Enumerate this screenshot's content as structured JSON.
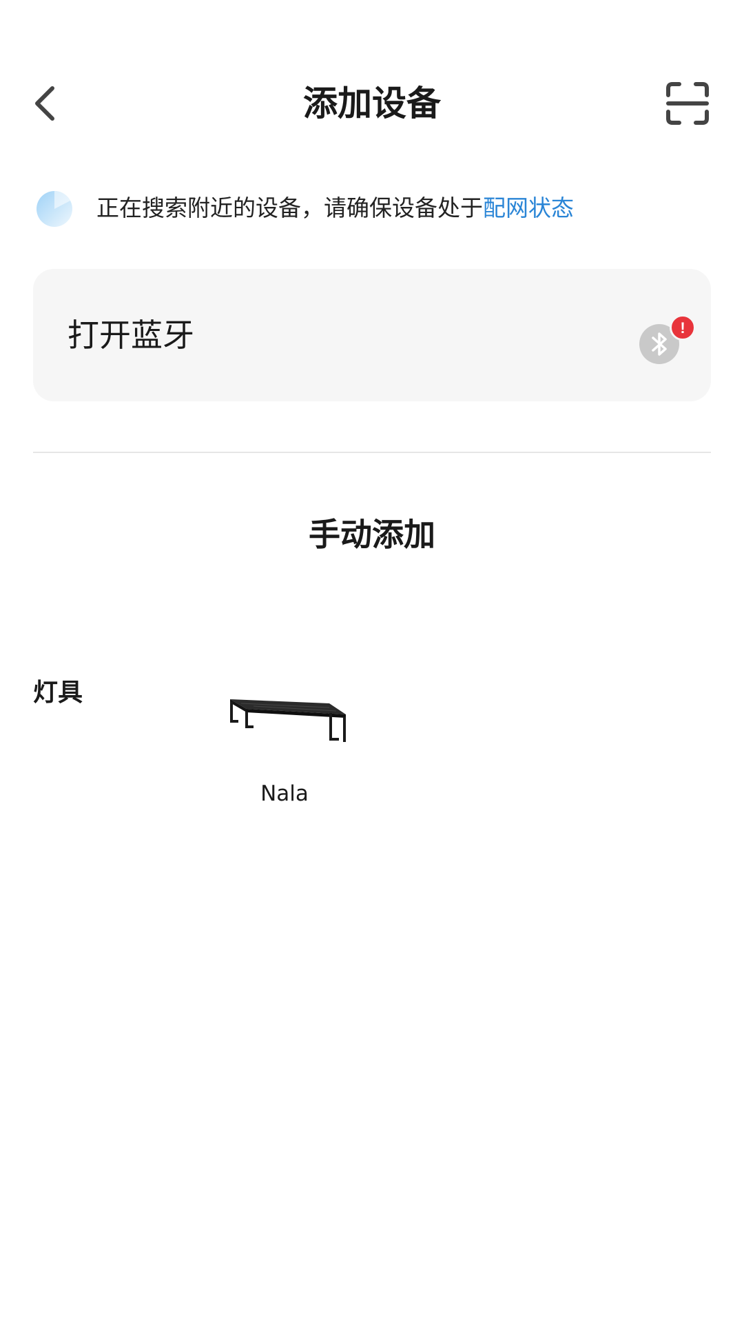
{
  "header": {
    "title": "添加设备",
    "back_icon": "chevron-left-icon",
    "scan_icon": "scan-icon"
  },
  "search_status": {
    "text": "正在搜索附近的设备，请确保设备处于",
    "link": "配网状态",
    "link_color": "#2a85d6",
    "icon": "searching-spinner-icon"
  },
  "bluetooth_card": {
    "label": "打开蓝牙",
    "icon": "bluetooth-icon",
    "alert_icon": "alert-badge-icon",
    "alert_color": "#e8343b",
    "alert_glyph": "!"
  },
  "manual_add": {
    "title": "手动添加"
  },
  "categories": [
    {
      "label": "灯具",
      "devices": [
        {
          "name": "Nala",
          "image": "aquarium-light-bar"
        }
      ]
    }
  ]
}
